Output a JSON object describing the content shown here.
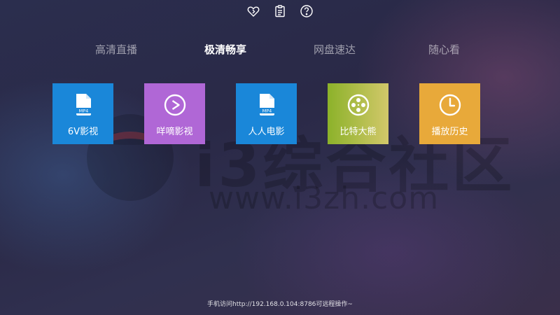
{
  "top_icons": [
    {
      "name": "favorite-heart-icon"
    },
    {
      "name": "clipboard-icon"
    },
    {
      "name": "help-icon"
    }
  ],
  "tabs": [
    {
      "label": "高清直播",
      "active": false
    },
    {
      "label": "极清畅享",
      "active": true
    },
    {
      "label": "网盘速达",
      "active": false
    },
    {
      "label": "随心看",
      "active": false
    }
  ],
  "tiles": [
    {
      "label": "6V影视",
      "icon": "mp4-file-icon",
      "color": "#1a87d9"
    },
    {
      "label": "咩嘀影视",
      "icon": "play-circle-icon",
      "color": "#b067d6"
    },
    {
      "label": "人人电影",
      "icon": "mp4-file-icon",
      "color": "#1a87d9"
    },
    {
      "label": "比特大熊",
      "icon": "film-reel-icon",
      "color_from": "#8cb22a",
      "color_to": "#d2c86a"
    },
    {
      "label": "播放历史",
      "icon": "clock-icon",
      "color": "#e8a93a"
    }
  ],
  "mp4_badge": "MP4",
  "watermark": {
    "text": "i3综合社区",
    "url": "www.i3zh.com"
  },
  "footer": "手机访问http://192.168.0.104:8786可远程操作~"
}
